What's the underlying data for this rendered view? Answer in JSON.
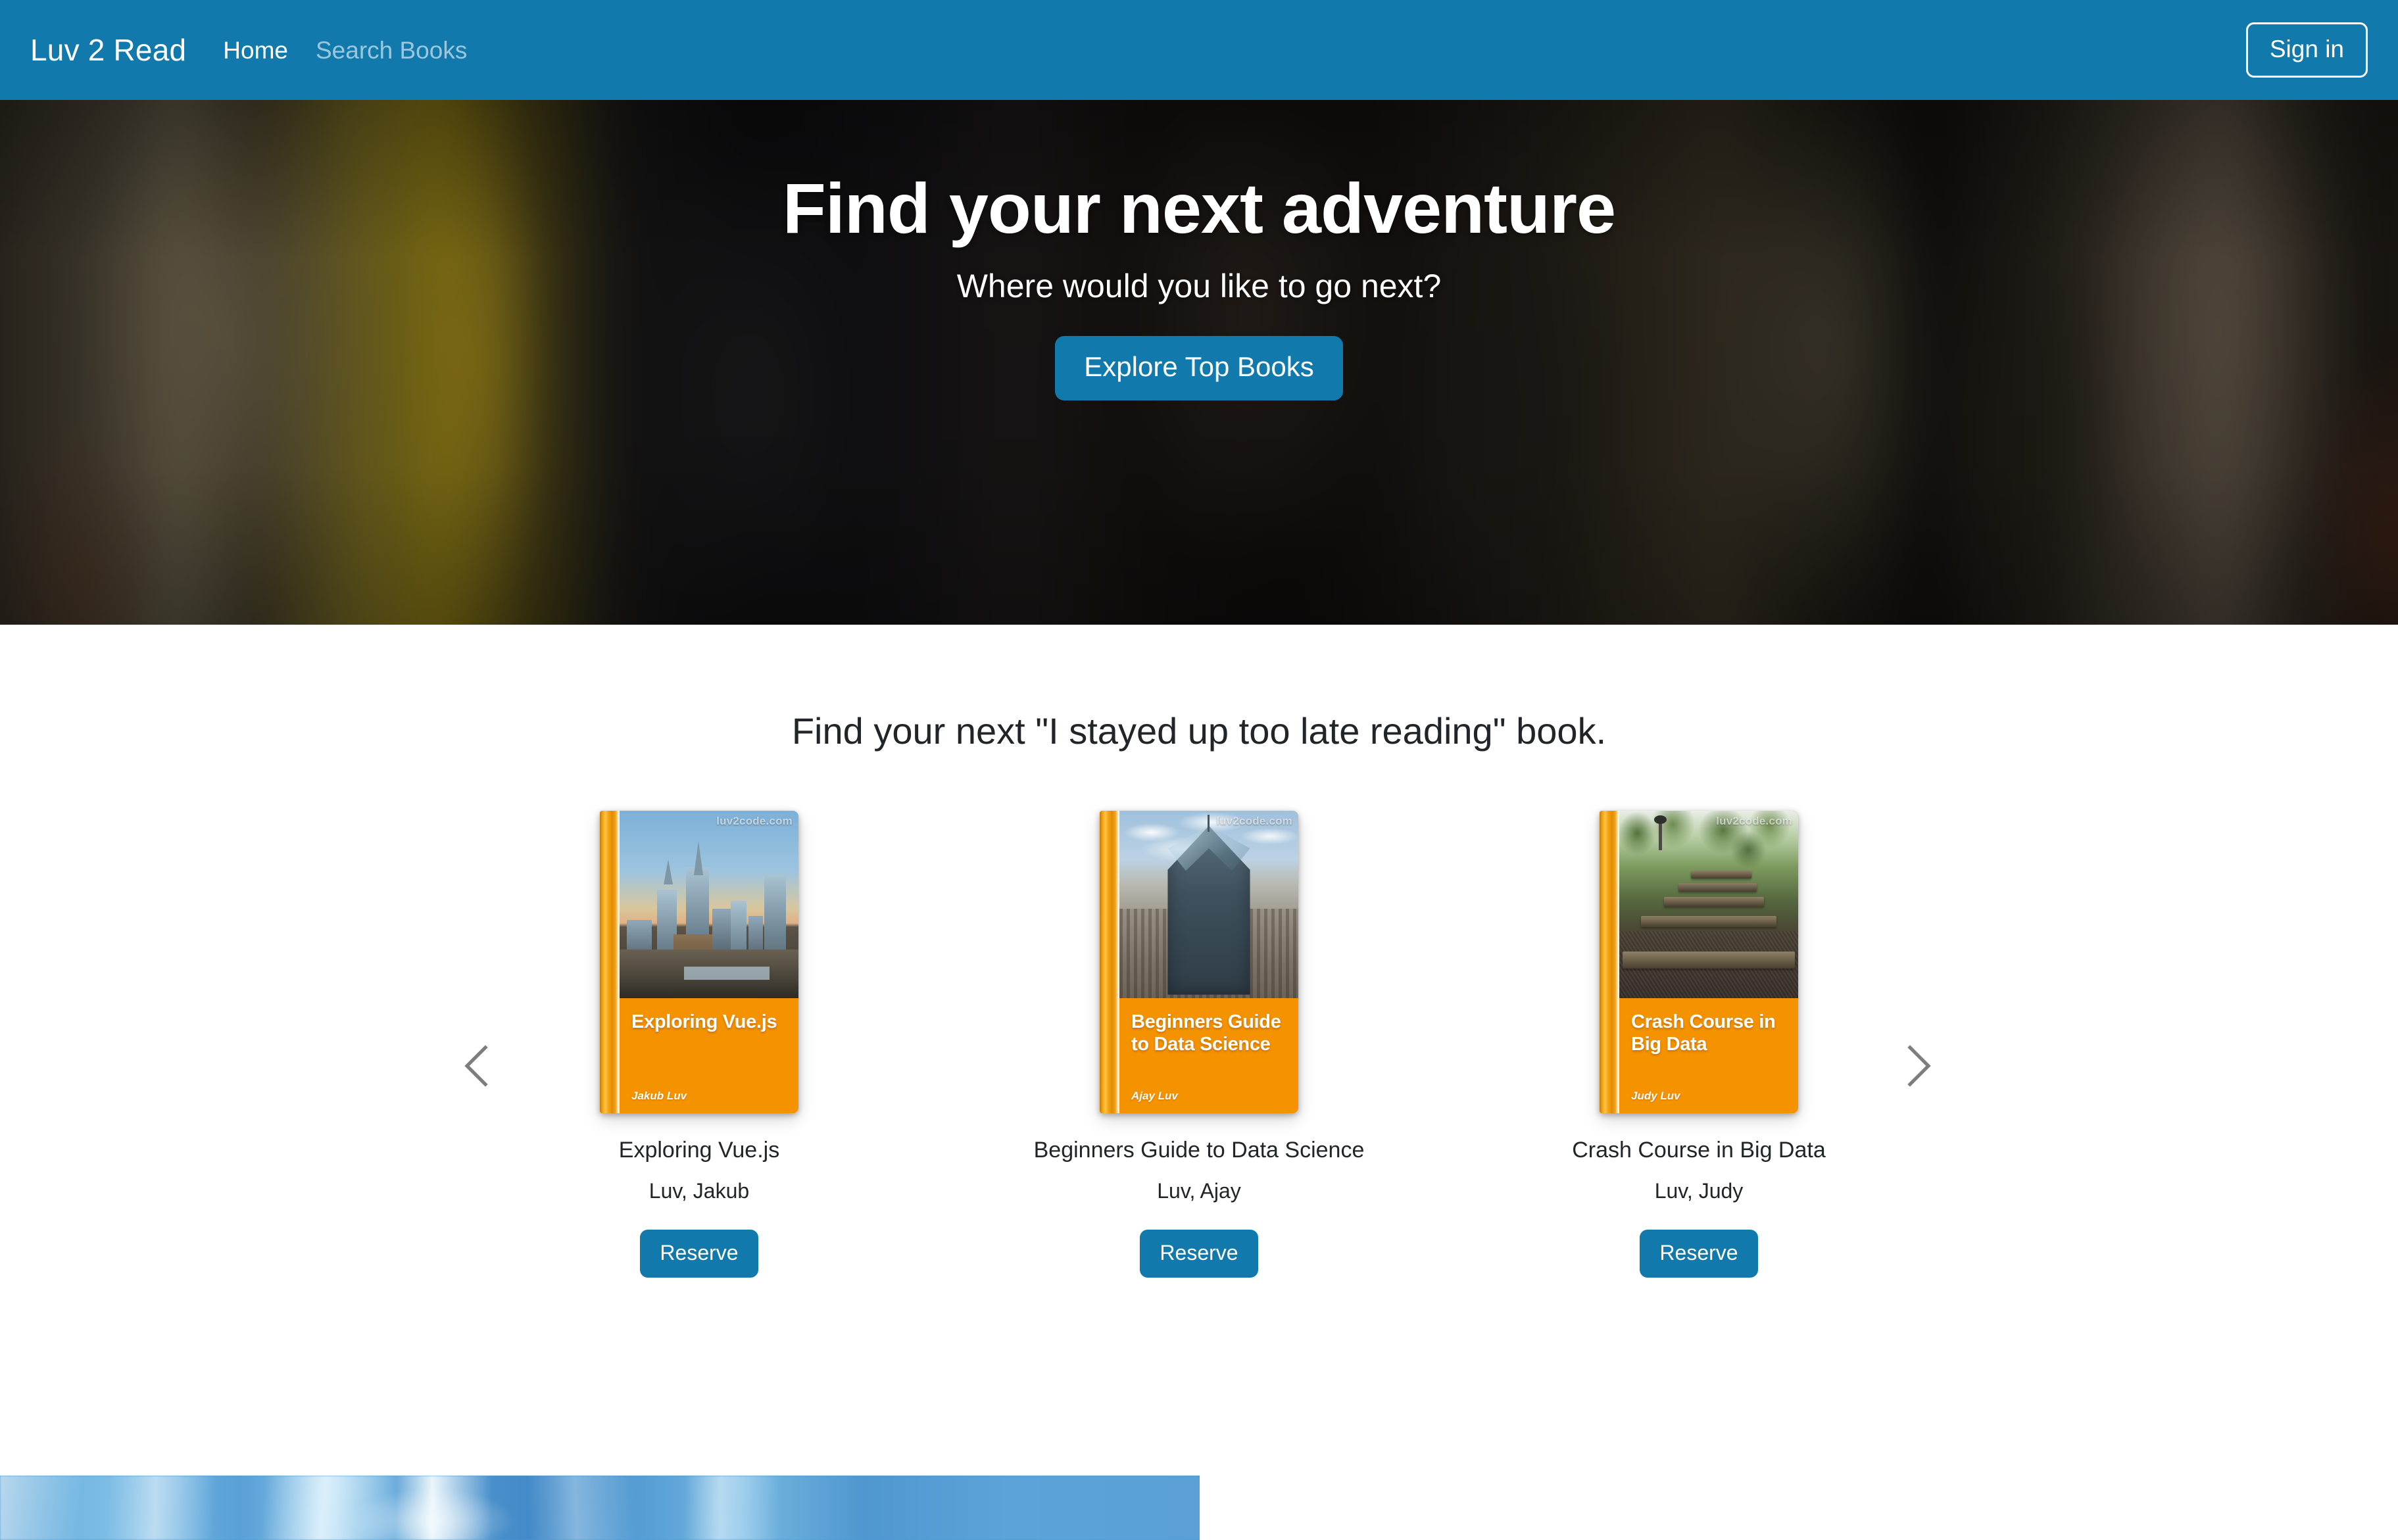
{
  "navbar": {
    "brand": "Luv 2 Read",
    "links": [
      {
        "label": "Home",
        "active": true
      },
      {
        "label": "Search Books",
        "active": false
      }
    ],
    "signin_label": "Sign in",
    "background_color": "#1179ab"
  },
  "hero": {
    "title": "Find your next adventure",
    "subtitle": "Where would you like to go next?",
    "cta_label": "Explore Top Books",
    "cta_color": "#1179ab"
  },
  "books_section": {
    "heading": "Find your next \"I stayed up too late reading\" book.",
    "prev_icon": "chevron-left-icon",
    "next_icon": "chevron-right-icon",
    "reserve_label": "Reserve",
    "books": [
      {
        "title": "Exploring Vue.js",
        "author": "Luv, Jakub",
        "cover_title": "Exploring Vue.js",
        "cover_author": "Jakub Luv",
        "cover_watermark": "luv2code.com",
        "cover_accent": "#f49200",
        "reserve_label": "Reserve"
      },
      {
        "title": "Beginners Guide to Data Science",
        "author": "Luv, Ajay",
        "cover_title": "Beginners Guide to Data Science",
        "cover_author": "Ajay Luv",
        "cover_watermark": "luv2code.com",
        "cover_accent": "#f49200",
        "reserve_label": "Reserve"
      },
      {
        "title": "Crash Course in Big Data",
        "author": "Luv, Judy",
        "cover_title": "Crash Course in Big Data",
        "cover_author": "Judy Luv",
        "cover_watermark": "luv2code.com",
        "cover_accent": "#f49200",
        "reserve_label": "Reserve"
      }
    ]
  },
  "footer_banner": {
    "image_name": "blue-sky-photo",
    "color": "#4e9ad4"
  }
}
